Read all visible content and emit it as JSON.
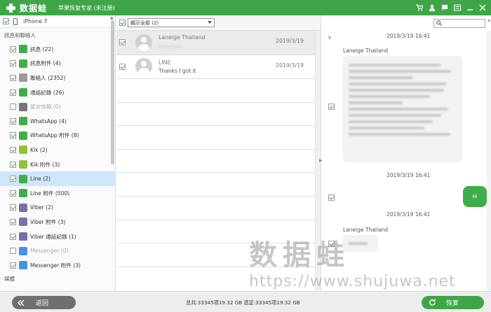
{
  "app": {
    "logo_text": "数据蛙",
    "subtitle": "苹果恢复专家 (未注册)"
  },
  "titlebar_icons": [
    "cart-icon",
    "user-icon",
    "chat-icon",
    "menu-icon",
    "minimize-icon",
    "close-icon"
  ],
  "device": {
    "name": "iPhone 7"
  },
  "sidebar": {
    "section_messages": "訊息和聯絡人",
    "section_media": "媒體",
    "items": [
      {
        "label": "訊息 (22)",
        "checked": true,
        "icon": "message-icon",
        "color": "#3fae49"
      },
      {
        "label": "訊息附件 (4)",
        "checked": true,
        "icon": "attachment-icon",
        "color": "#3fae49"
      },
      {
        "label": "聯絡人 (2352)",
        "checked": true,
        "icon": "contacts-icon",
        "color": "#9a9a9a"
      },
      {
        "label": "通話記錄 (26)",
        "checked": true,
        "icon": "phone-icon",
        "color": "#3fae49"
      },
      {
        "label": "留言信箱 (0)",
        "checked": false,
        "icon": "voicemail-icon",
        "color": "#777"
      },
      {
        "label": "WhatsApp (4)",
        "checked": true,
        "icon": "whatsapp-icon",
        "color": "#3fae49"
      },
      {
        "label": "WhatsApp 附件 (8)",
        "checked": true,
        "icon": "whatsapp-attachment-icon",
        "color": "#3fae49"
      },
      {
        "label": "Kik (2)",
        "checked": true,
        "icon": "kik-icon",
        "color": "#8fc23f"
      },
      {
        "label": "Kik 附件 (3)",
        "checked": true,
        "icon": "kik-attachment-icon",
        "color": "#8fc23f"
      },
      {
        "label": "Line (2)",
        "checked": true,
        "icon": "line-icon",
        "color": "#3fae49"
      },
      {
        "label": "Line 附件 (500)",
        "checked": true,
        "icon": "line-attachment-icon",
        "color": "#3fae49"
      },
      {
        "label": "Viber (2)",
        "checked": true,
        "icon": "viber-icon",
        "color": "#7b6fa8"
      },
      {
        "label": "Viber 附件 (3)",
        "checked": true,
        "icon": "viber-attachment-icon",
        "color": "#7b6fa8"
      },
      {
        "label": "Viber 通話記錄 (1)",
        "checked": true,
        "icon": "viber-call-icon",
        "color": "#7b6fa8"
      },
      {
        "label": "Messenger (0)",
        "checked": false,
        "icon": "messenger-icon",
        "color": "#4a90e2"
      },
      {
        "label": "Messenger 附件 (3)",
        "checked": true,
        "icon": "messenger-attachment-icon",
        "color": "#4a90e2"
      }
    ]
  },
  "middle": {
    "filter_value": "顯示全部 (2)",
    "conversations": [
      {
        "name": "Laneige Thailand",
        "preview": "ขอบคุณค่ะ",
        "date": "2019/3/19",
        "checked": true
      },
      {
        "name": "LINE",
        "preview": "Thanks I got it",
        "date": "2019/3/19",
        "checked": true
      }
    ]
  },
  "detail": {
    "messages": [
      {
        "time": "2019/3/19 16:41",
        "sender": "Laneige Thailand"
      },
      {
        "time": "2019/3/19 16:41",
        "text": "Hi"
      },
      {
        "time": "2019/3/19 16:41",
        "sender": "Laneige Thailand"
      }
    ]
  },
  "watermark": {
    "cn": "数据蛙",
    "url": "https://www.shujuwa.net"
  },
  "bottom": {
    "back_label": "返回",
    "status": "总共:33345项19.32 GB 选定:33345项19.32 GB",
    "restore_label": "恢复"
  }
}
